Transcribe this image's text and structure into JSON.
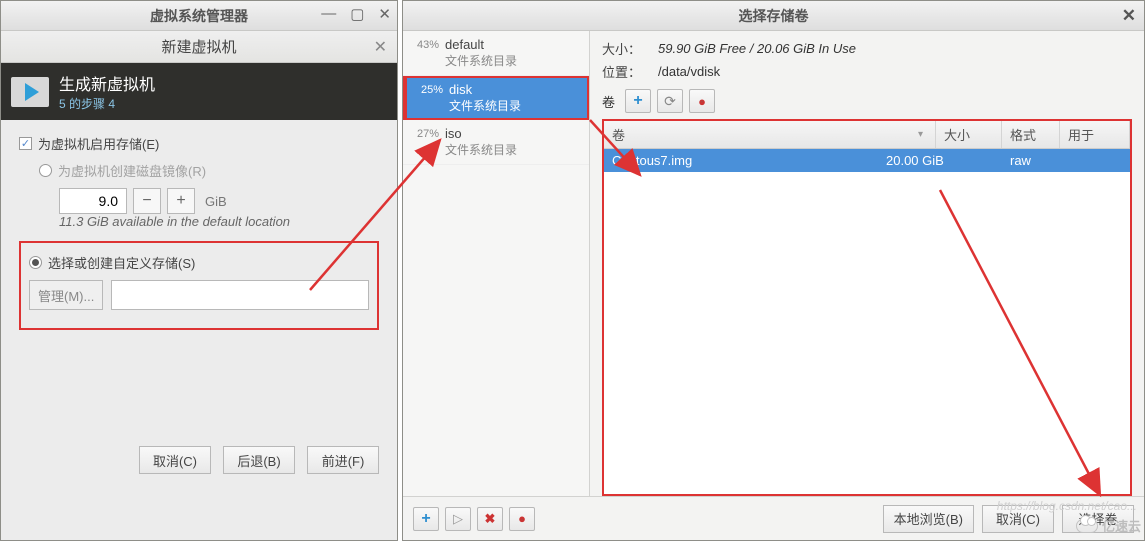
{
  "left": {
    "window_title": "虚拟系统管理器",
    "dialog_title": "新建虚拟机",
    "banner_title": "生成新虚拟机",
    "banner_step": "5 的步骤 4",
    "enable_storage": "为虚拟机启用存储(E)",
    "create_disk_image": "为虚拟机创建磁盘镜像(R)",
    "disk_size_value": "9.0",
    "disk_unit": "GiB",
    "available_note": "11.3 GiB available in the default location",
    "custom_storage": "选择或创建自定义存储(S)",
    "manage_btn": "管理(M)...",
    "btn_cancel": "取消(C)",
    "btn_back": "后退(B)",
    "btn_forward": "前进(F)"
  },
  "right": {
    "window_title": "选择存储卷",
    "pools": [
      {
        "pct": "43%",
        "name": "default",
        "sub": "文件系统目录"
      },
      {
        "pct": "25%",
        "name": "disk",
        "sub": "文件系统目录"
      },
      {
        "pct": "27%",
        "name": "iso",
        "sub": "文件系统目录"
      }
    ],
    "size_label": "大小：",
    "size_value": "59.90 GiB Free / 20.06 GiB In Use",
    "location_label": "位置：",
    "location_value": "/data/vdisk",
    "vol_label": "卷",
    "table": {
      "col_name": "卷",
      "col_size": "大小",
      "col_fmt": "格式",
      "col_use": "用于"
    },
    "volumes": [
      {
        "name": "Centous7.img",
        "size": "20.00 GiB",
        "fmt": "raw",
        "use": ""
      }
    ],
    "footer": {
      "local_browse": "本地浏览(B)",
      "cancel": "取消(C)",
      "choose": "选择卷"
    }
  },
  "marks": {
    "watermark": "https://blog.csdn.net/cao...",
    "brand": "亿速云"
  }
}
